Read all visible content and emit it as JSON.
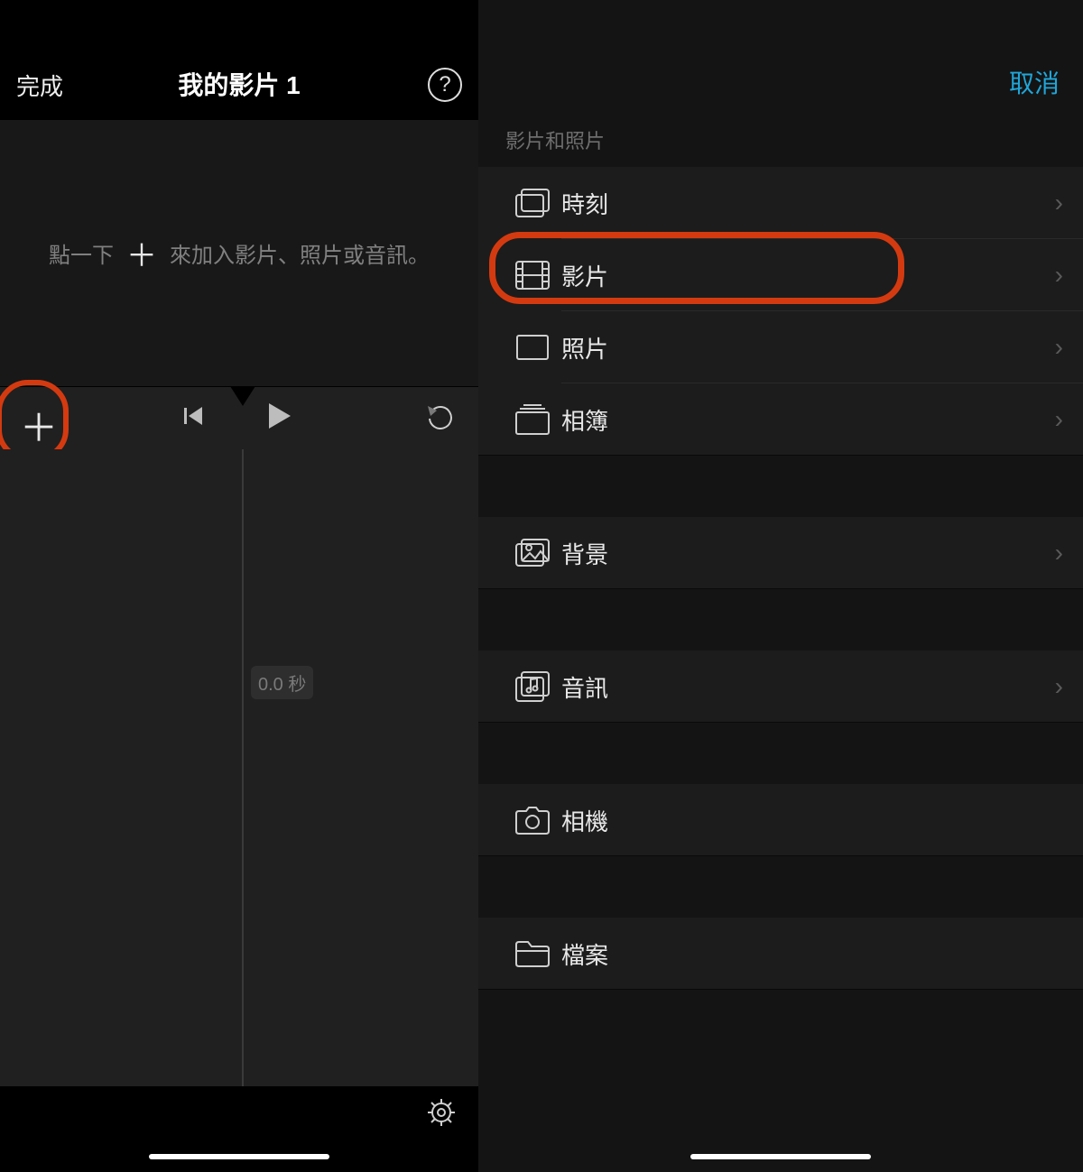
{
  "editor": {
    "done_label": "完成",
    "title": "我的影片 1",
    "help_glyph": "?",
    "hint_prefix": "點一下",
    "hint_suffix": "來加入影片、照片或音訊。",
    "time_pill": "0.0 秒"
  },
  "picker": {
    "cancel_label": "取消",
    "section_label": "影片和照片",
    "rows": {
      "moments": "時刻",
      "video": "影片",
      "photos": "照片",
      "albums": "相簿",
      "backgrounds": "背景",
      "audio": "音訊",
      "camera": "相機",
      "files": "檔案"
    }
  },
  "glyphs": {
    "plus": "＋",
    "chevron": "›"
  },
  "colors": {
    "accent_highlight": "#d43a10",
    "link": "#1fa6d9"
  }
}
